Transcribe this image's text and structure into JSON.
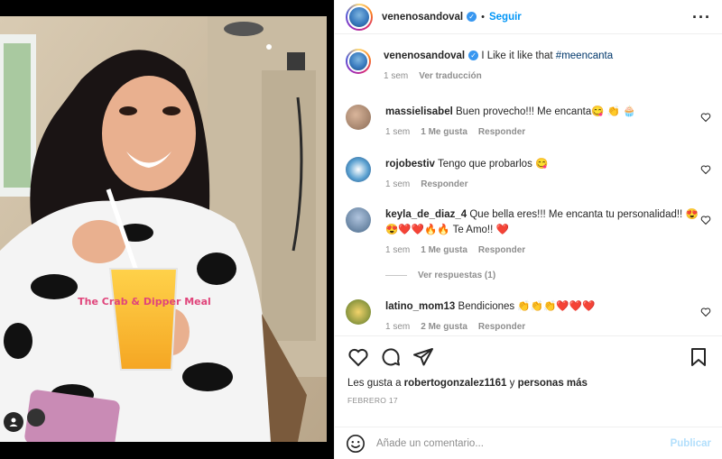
{
  "post": {
    "username": "venenosandoval",
    "follow_label": "Seguir",
    "caption_text": "I Like it like that",
    "caption_hashtag": "#meencanta",
    "caption_time": "1 sem",
    "caption_translate": "Ver traducción",
    "photo_cup_text": "The Crab & Dipper Meal"
  },
  "comments": [
    {
      "user": "massielisabel",
      "text": "Buen provecho!!! Me encanta😋 👏 🧁",
      "time": "1 sem",
      "likes": "1 Me gusta",
      "reply": "Responder"
    },
    {
      "user": "rojobestiv",
      "text": "Tengo que probarlos 😋",
      "time": "1 sem",
      "likes": "",
      "reply": "Responder"
    },
    {
      "user": "keyla_de_diaz_4",
      "text": "Que bella eres!!! Me encanta tu personalidad!! 😍😍❤️❤️🔥🔥 Te Amo!! ❤️",
      "time": "1 sem",
      "likes": "1 Me gusta",
      "reply": "Responder",
      "view_replies": "Ver respuestas (1)"
    },
    {
      "user": "latino_mom13",
      "text": "Bendiciones 👏👏👏❤️❤️❤️",
      "time": "1 sem",
      "likes": "2 Me gusta",
      "reply": "Responder"
    }
  ],
  "likes": {
    "prefix": "Les gusta a",
    "user": "robertogonzalez1161",
    "and": "y",
    "others": "personas más"
  },
  "date": "FEBRERO 17",
  "add_comment": {
    "placeholder": "Añade un comentario...",
    "publish_label": "Publicar"
  },
  "icons": {
    "more": "more-options-icon",
    "like": "heart-icon",
    "comment": "comment-icon",
    "share": "share-icon",
    "save": "bookmark-icon",
    "emoji": "emoji-icon",
    "tag": "user-tag-icon"
  },
  "colors": {
    "accent": "#0095f6",
    "verified": "#3897f0",
    "muted": "#8e8e8e",
    "publish_disabled": "#b2dffc"
  }
}
